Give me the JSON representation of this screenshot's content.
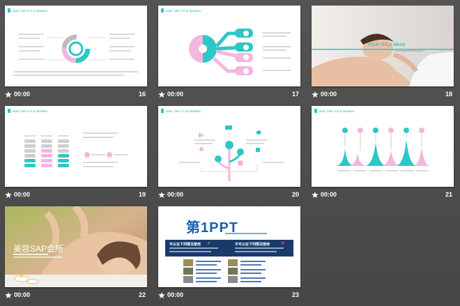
{
  "colors": {
    "accent": "#2ec6c6",
    "pink": "#f3b6e0",
    "gray": "#bdbdbd",
    "background": "#4d4d4d",
    "navy": "#1a3a6a"
  },
  "slides": [
    {
      "num": "16",
      "time": "00:00",
      "title": "ADD THE TITLE WORDS"
    },
    {
      "num": "17",
      "time": "00:00",
      "title": "ADD THE TITLE WORDS"
    },
    {
      "num": "18",
      "time": "00:00",
      "heading": "YOUR TITLE HEAD"
    },
    {
      "num": "19",
      "time": "00:00",
      "title": "ADD THE TITLE WORDS"
    },
    {
      "num": "20",
      "time": "00:00",
      "title": "ADD THE TITLE WORDS"
    },
    {
      "num": "21",
      "time": "00:00",
      "title": "ADD THE TITLE WORDS"
    },
    {
      "num": "22",
      "time": "00:00",
      "heading": "美容SAP会所"
    },
    {
      "num": "23",
      "time": "00:00",
      "logo": "第1PPT",
      "can_use": "可以在下列情况使用",
      "cannot_use": "不可以在下列情况使用"
    }
  ]
}
